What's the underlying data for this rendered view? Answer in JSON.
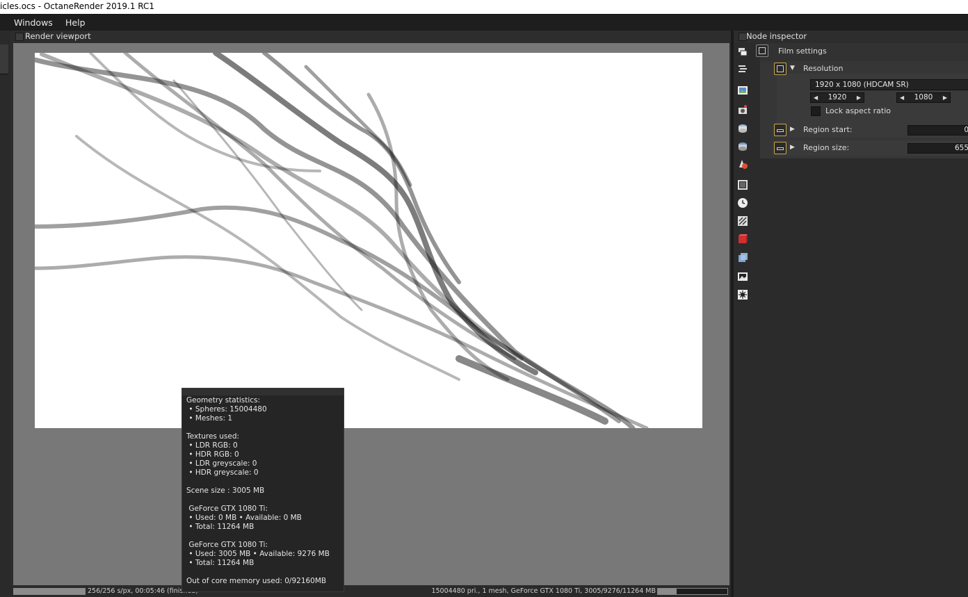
{
  "window": {
    "title": "icles.ocs - OctaneRender 2019.1 RC1"
  },
  "menu": {
    "items": [
      "Windows",
      "Help"
    ]
  },
  "viewport": {
    "header_title": "Render viewport",
    "status_left": "256/256 s/px, 00:05:46 (finished)",
    "status_right": "15004480 pri., 1 mesh, GeForce GTX 1080 Ti, 3005/9276/11264 MB",
    "render_progress": 1.0,
    "memory_usage_fraction": 0.27
  },
  "stats": {
    "lines": [
      "Geometry statistics:",
      " • Spheres: 15004480",
      " • Meshes: 1",
      "",
      "Textures used:",
      " • LDR RGB: 0",
      " • HDR RGB: 0",
      " • LDR greyscale: 0",
      " • HDR greyscale: 0",
      "",
      "Scene size : 3005 MB",
      "",
      " GeForce GTX 1080 Ti:",
      " • Used: 0 MB • Available: 0 MB",
      " • Total: 11264 MB",
      "",
      " GeForce GTX 1080 Ti:",
      " • Used: 3005 MB • Available: 9276 MB",
      " • Total: 11264 MB",
      "",
      "Out of core memory used: 0/92160MB"
    ]
  },
  "inspector": {
    "header_title": "Node inspector",
    "film_settings_label": "Film settings",
    "resolution_label": "Resolution",
    "resolution_preset": "1920 x 1080 (HDCAM SR)",
    "width": "1920",
    "height": "1080",
    "lock_aspect_label": "Lock aspect ratio",
    "region_start_label": "Region start:",
    "region_start_value": "0",
    "region_size_label": "Region size:",
    "region_size_value": "655"
  },
  "icons": {
    "side_icons": [
      "layers-icon",
      "menu-lines-icon",
      "image-icon",
      "camera-icon",
      "environment-icon",
      "environment-alt-icon",
      "material-icon",
      "film-icon",
      "clock-icon",
      "texture-icon",
      "red-cube-icon",
      "blue-cube-icon",
      "picture-icon",
      "light-icon"
    ]
  },
  "colors": {
    "accent_border": "#c8a84a",
    "viewport_bg": "#787878"
  }
}
